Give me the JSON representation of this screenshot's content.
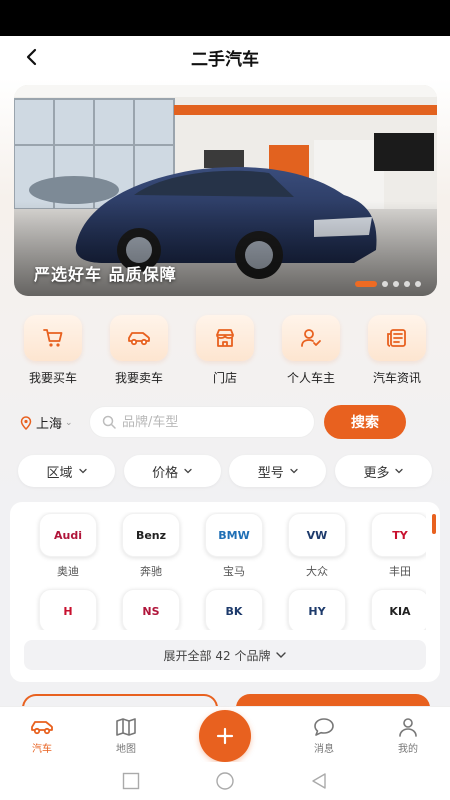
{
  "header": {
    "title": "二手汽车",
    "back_icon": "back-arrow-icon"
  },
  "banner": {
    "slogan": "严选好车 品质保障",
    "slides_total": 5,
    "active_slide": 1
  },
  "quick_menu": [
    {
      "label": "我要买车",
      "icon": "shopping-cart-icon"
    },
    {
      "label": "我要卖车",
      "icon": "car-icon"
    },
    {
      "label": "门店",
      "icon": "store-icon"
    },
    {
      "label": "个人车主",
      "icon": "user-check-icon"
    },
    {
      "label": "汽车资讯",
      "icon": "news-icon"
    }
  ],
  "search": {
    "city": "上海",
    "placeholder": "品牌/车型",
    "value": "",
    "button_label": "搜索"
  },
  "filters": [
    {
      "label": "区域"
    },
    {
      "label": "价格"
    },
    {
      "label": "型号"
    },
    {
      "label": "更多"
    }
  ],
  "brands": [
    {
      "logo": "Audi",
      "name": "奥迪",
      "color": "#b0153a"
    },
    {
      "logo": "Benz",
      "name": "奔驰",
      "color": "#222222"
    },
    {
      "logo": "BMW",
      "name": "宝马",
      "color": "#1f6fb5"
    },
    {
      "logo": "VW",
      "name": "大众",
      "color": "#1d3a6b"
    },
    {
      "logo": "TY",
      "name": "丰田",
      "color": "#c8102e"
    },
    {
      "logo": "H",
      "name": "",
      "color": "#c8102e"
    },
    {
      "logo": "NS",
      "name": "",
      "color": "#b0153a"
    },
    {
      "logo": "BK",
      "name": "",
      "color": "#1d3a6b"
    },
    {
      "logo": "HY",
      "name": "",
      "color": "#1d3a6b"
    },
    {
      "logo": "KIA",
      "name": "",
      "color": "#222222"
    }
  ],
  "expand_label": "展开全部 42 个品牌",
  "tabbar": [
    {
      "label": "汽车",
      "icon": "car-icon",
      "active": true
    },
    {
      "label": "地图",
      "icon": "map-icon",
      "active": false
    },
    {
      "label": "消息",
      "icon": "message-icon",
      "active": false
    },
    {
      "label": "我的",
      "icon": "profile-icon",
      "active": false
    }
  ],
  "colors": {
    "accent": "#e8611f",
    "accent_light": "#fde5d0"
  }
}
